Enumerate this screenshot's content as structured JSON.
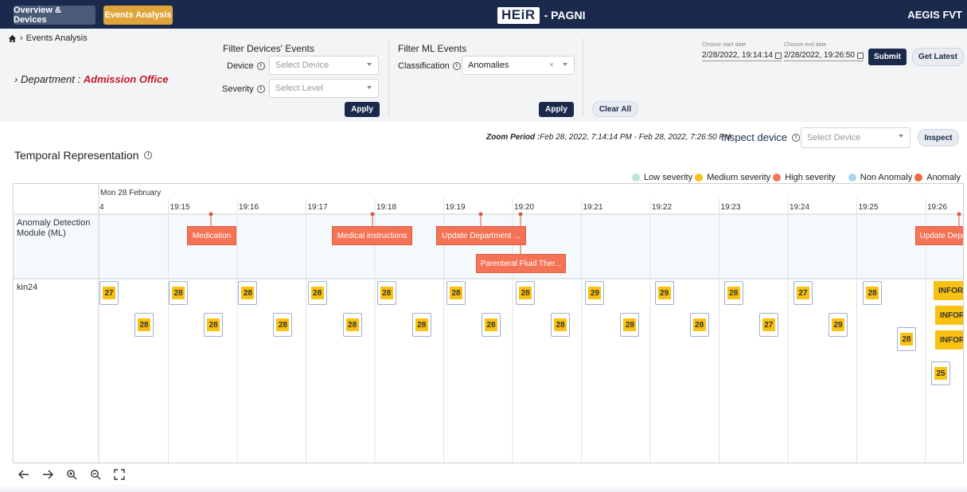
{
  "nav": {
    "overview_label": "Overview & Devices",
    "events_label": "Events Analysis",
    "brand_logo": "HEiR",
    "brand_sub": "- PAGNI",
    "org": "AEGIS FVT"
  },
  "breadcrumb": {
    "current": "Events Analysis"
  },
  "department": {
    "label": "Department :",
    "value": "Admission Office"
  },
  "device_filter": {
    "title": "Filter Devices' Events",
    "device_label": "Device",
    "device_placeholder": "Select Device",
    "severity_label": "Severity",
    "severity_placeholder": "Select Level",
    "apply_label": "Apply"
  },
  "ml_filter": {
    "title": "Filter ML Events",
    "classification_label": "Classification",
    "classification_value": "Anomalies",
    "apply_label": "Apply",
    "clear_label": "Clear All"
  },
  "date_range": {
    "start_label": "Choose start date",
    "start_value": "2/28/2022, 19:14:14",
    "end_label": "Choose end date",
    "end_value": "2/28/2022, 19:26:50",
    "submit_label": "Submit",
    "latest_label": "Get Latest"
  },
  "zoom": {
    "prefix": "Zoom Period :",
    "period": "Feb 28, 2022, 7:14:14 PM - Feb 28, 2022, 7:26:50 PM"
  },
  "inspect": {
    "label": "Inspect device",
    "placeholder": "Select Device",
    "button_label": "Inspect"
  },
  "section_title": "Temporal Representation",
  "legend": [
    {
      "label": "Low severity",
      "color": "#b9e6d6"
    },
    {
      "label": "Medium severity",
      "color": "#f9c112"
    },
    {
      "label": "High severity",
      "color": "#f47356"
    },
    {
      "label": "Non Anomaly",
      "color": "#a9d3ee"
    },
    {
      "label": "Anomaly",
      "color": "#f06a3b"
    }
  ],
  "timeline": {
    "date_label": "Mon 28 February",
    "time_ticks": [
      "4",
      "19:15",
      "19:16",
      "19:17",
      "19:18",
      "19:19",
      "19:20",
      "19:21",
      "19:22",
      "19:23",
      "19:24",
      "19:25",
      "19:26"
    ],
    "groups": {
      "ml": "Anomaly Detection Module (ML)",
      "device": "kin24"
    },
    "ml_events": [
      "Medication",
      "Medical instructions",
      "Update Department ...",
      "Parenteral Fluid Ther...",
      "Update Depa"
    ],
    "device_values_row1": [
      27,
      28,
      28,
      28,
      28,
      28,
      28,
      29,
      29,
      28,
      27,
      28
    ],
    "device_values_row2": [
      28,
      28,
      28,
      28,
      28,
      28,
      28,
      28,
      28,
      27,
      29
    ],
    "device_values_extra": [
      28,
      25
    ],
    "info_events": [
      "INFORM",
      "INFORI",
      "INFORI"
    ]
  },
  "colors": {
    "navy": "#1b2a4c",
    "accent": "#e0a53a",
    "department": "#c8182b",
    "ml_event": "#f47356",
    "device_event": "#f9c112"
  },
  "toolbar": [
    "left-arrow-icon",
    "right-arrow-icon",
    "zoom-in-icon",
    "zoom-out-icon",
    "fit-screen-icon"
  ]
}
